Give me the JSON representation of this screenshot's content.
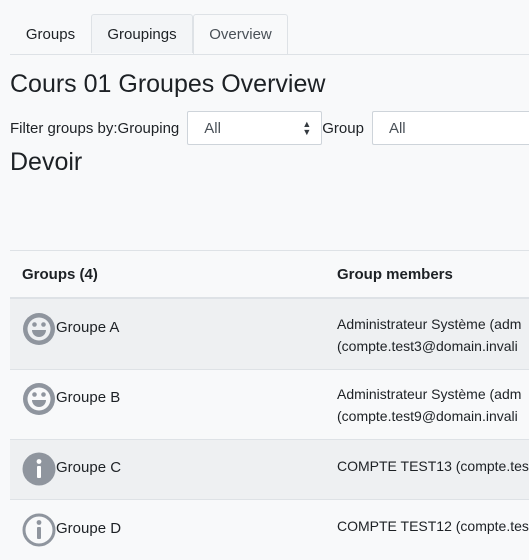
{
  "tabs": [
    {
      "label": "Groups"
    },
    {
      "label": "Groupings"
    },
    {
      "label": "Overview"
    }
  ],
  "page_title": "Cours 01 Groupes Overview",
  "filter": {
    "label": "Filter groups by:Grouping",
    "grouping_value": "All",
    "group_label": "Group",
    "group_value": "All"
  },
  "section_title": "Devoir",
  "table": {
    "headers": {
      "groups": "Groups (4)",
      "members": "Group members"
    },
    "rows": [
      {
        "name": "Groupe A",
        "icon": "smiley-icon",
        "members": [
          "Administrateur Système (adm",
          "(compte.test3@domain.invali"
        ]
      },
      {
        "name": "Groupe B",
        "icon": "smiley-icon",
        "members": [
          "Administrateur Système (adm",
          "(compte.test9@domain.invali"
        ]
      },
      {
        "name": "Groupe C",
        "icon": "info-filled-icon",
        "members": [
          "COMPTE TEST13 (compte.tes"
        ]
      },
      {
        "name": "Groupe D",
        "icon": "info-outline-icon",
        "members": [
          "COMPTE TEST12 (compte.tes"
        ]
      }
    ]
  },
  "colors": {
    "icon_grey": "#8f959e",
    "row_stripe": "#eef0f2",
    "border": "#dee2e6"
  }
}
